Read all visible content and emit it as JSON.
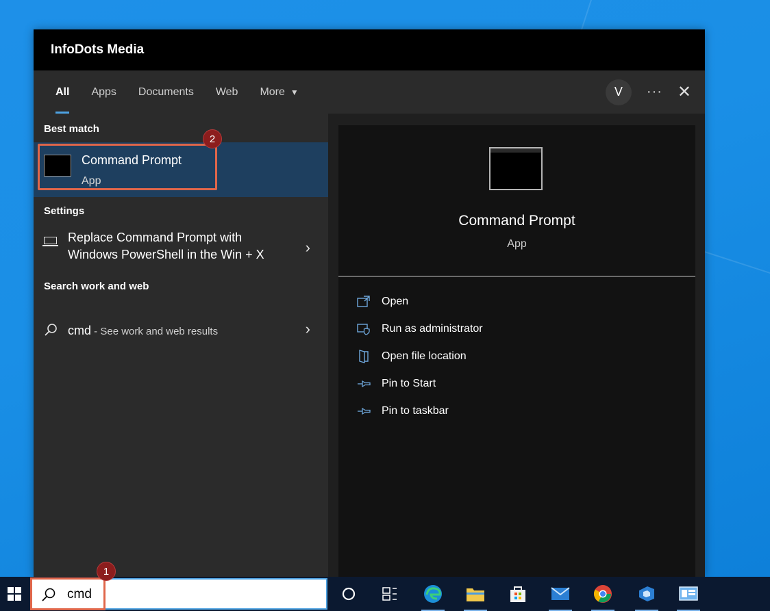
{
  "window": {
    "org_name": "InfoDots Media"
  },
  "tabs": [
    {
      "label": "All",
      "active": true
    },
    {
      "label": "Apps"
    },
    {
      "label": "Documents"
    },
    {
      "label": "Web"
    },
    {
      "label": "More"
    }
  ],
  "header_right": {
    "avatar_initial": "V",
    "more_glyph": "···",
    "close_glyph": "✕"
  },
  "left": {
    "best_match_title": "Best match",
    "best_match": {
      "name": "Command Prompt",
      "type": "App"
    },
    "settings_title": "Settings",
    "setting_item": {
      "line1": "Replace Command Prompt with",
      "line2": "Windows PowerShell in the Win + X"
    },
    "web_title": "Search work and web",
    "web_item": {
      "query": "cmd",
      "suffix": " - See work and web results"
    }
  },
  "preview": {
    "name": "Command Prompt",
    "type": "App",
    "actions": [
      {
        "label": "Open",
        "icon": "open-icon"
      },
      {
        "label": "Run as administrator",
        "icon": "shield-icon"
      },
      {
        "label": "Open file location",
        "icon": "file-location-icon"
      },
      {
        "label": "Pin to Start",
        "icon": "pin-icon"
      },
      {
        "label": "Pin to taskbar",
        "icon": "pin-icon"
      }
    ]
  },
  "annotations": {
    "step1": "1",
    "step2": "2"
  },
  "taskbar": {
    "search_value": "cmd",
    "icons": [
      "cortana-icon",
      "task-view-icon",
      "edge-icon",
      "file-explorer-icon",
      "store-icon",
      "mail-icon",
      "chrome-icon",
      "azure-devops-icon",
      "control-panel-icon"
    ]
  },
  "colors": {
    "accent": "#4ea3e3",
    "highlight": "#e0664a",
    "badge": "#8c1d1d",
    "selection": "#1e3f5f"
  }
}
